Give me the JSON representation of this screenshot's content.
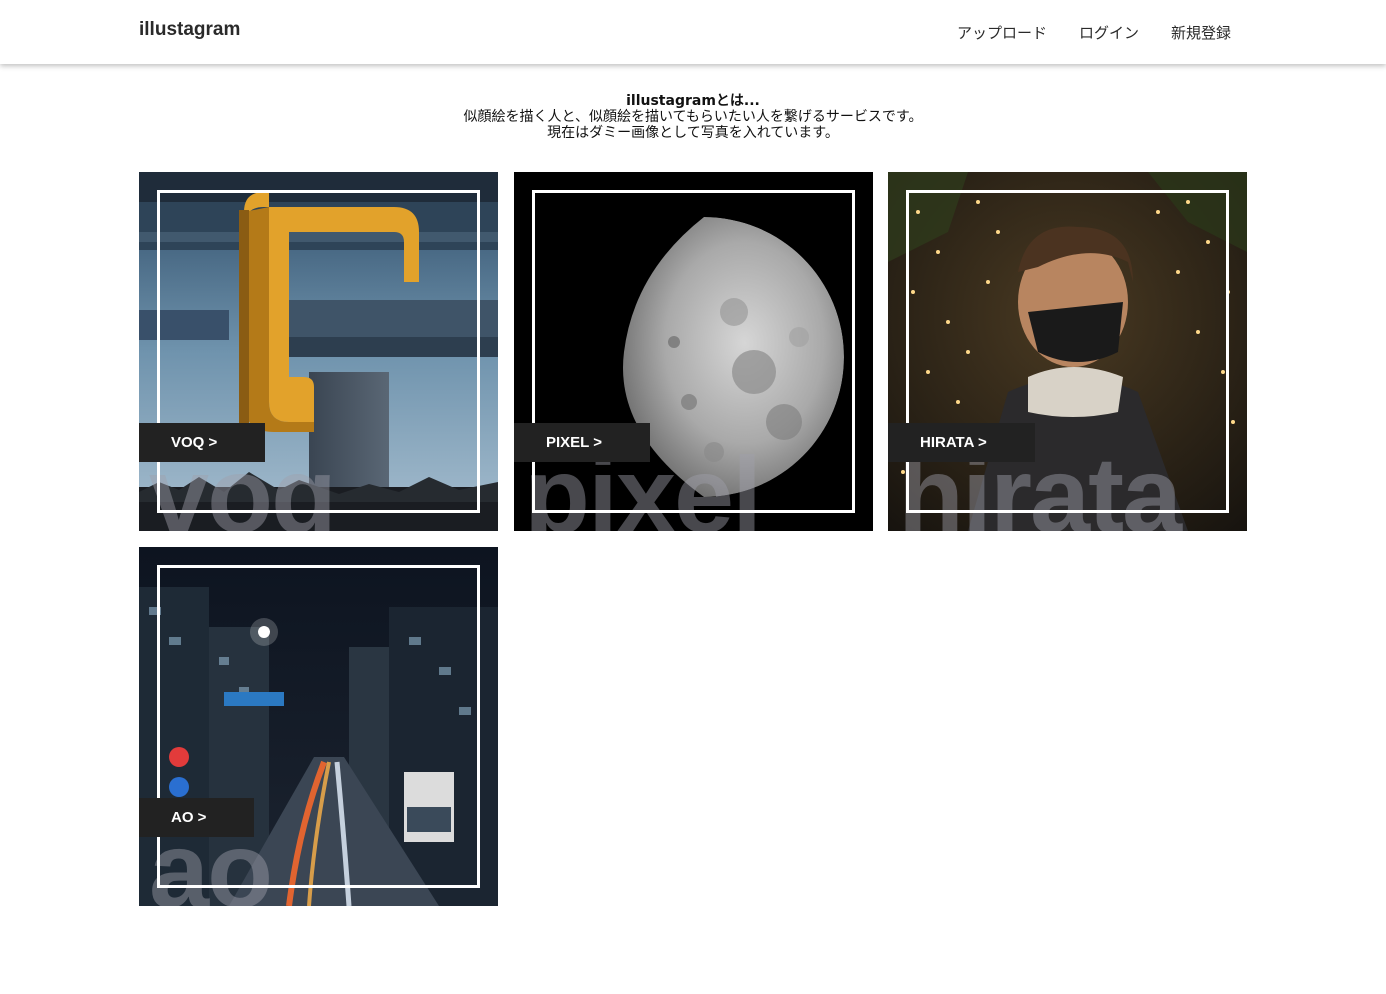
{
  "header": {
    "brand": "illustagram",
    "nav": [
      {
        "label": "アップロード"
      },
      {
        "label": "ログイン"
      },
      {
        "label": "新規登録"
      }
    ]
  },
  "intro": {
    "title": "illustagramとは...",
    "line1": "似顔絵を描く人と、似顔絵を描いてもらいたい人を繋げるサービスです。",
    "line2": "現在はダミー画像として写真を入れています。"
  },
  "cards": [
    {
      "label": "VOQ >",
      "watermark": "voq",
      "image": "overpass-photo"
    },
    {
      "label": "PIXEL >",
      "watermark": "pixel",
      "image": "moon-photo"
    },
    {
      "label": "HIRATA >",
      "watermark": "hirata",
      "image": "portrait-photo"
    },
    {
      "label": "AO >",
      "watermark": "ao",
      "image": "night-street-photo"
    }
  ]
}
